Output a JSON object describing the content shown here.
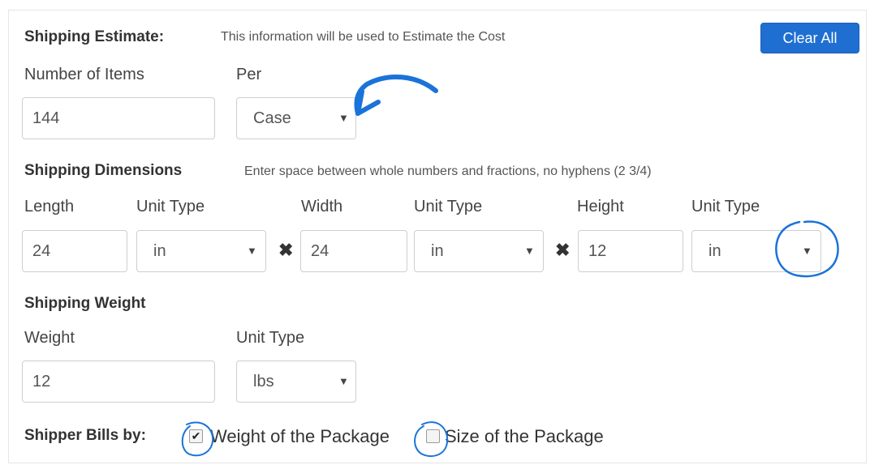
{
  "estimate": {
    "title": "Shipping Estimate:",
    "hint": "This information will be used to Estimate the Cost",
    "clear_all_label": "Clear All",
    "items_label": "Number of Items",
    "per_label": "Per",
    "items_value": "144",
    "per_value": "Case"
  },
  "dimensions": {
    "title": "Shipping Dimensions",
    "hint": "Enter space between whole numbers and fractions, no hyphens (2 3/4)",
    "length_label": "Length",
    "width_label": "Width",
    "height_label": "Height",
    "unit_label": "Unit Type",
    "length_value": "24",
    "width_value": "24",
    "height_value": "12",
    "length_unit": "in",
    "width_unit": "in",
    "height_unit": "in"
  },
  "weight": {
    "title": "Shipping Weight",
    "weight_label": "Weight",
    "unit_label": "Unit Type",
    "weight_value": "12",
    "weight_unit": "lbs"
  },
  "bills": {
    "title": "Shipper Bills by:",
    "option_weight": "Weight of the Package",
    "option_size": "Size of the Package",
    "weight_checked": true,
    "size_checked": false
  },
  "icons": {
    "caret": "caret-down-icon",
    "times": "times-icon",
    "check": "check-icon"
  },
  "colors": {
    "button": "#1f6fd2",
    "annotation": "#1a73d9"
  }
}
